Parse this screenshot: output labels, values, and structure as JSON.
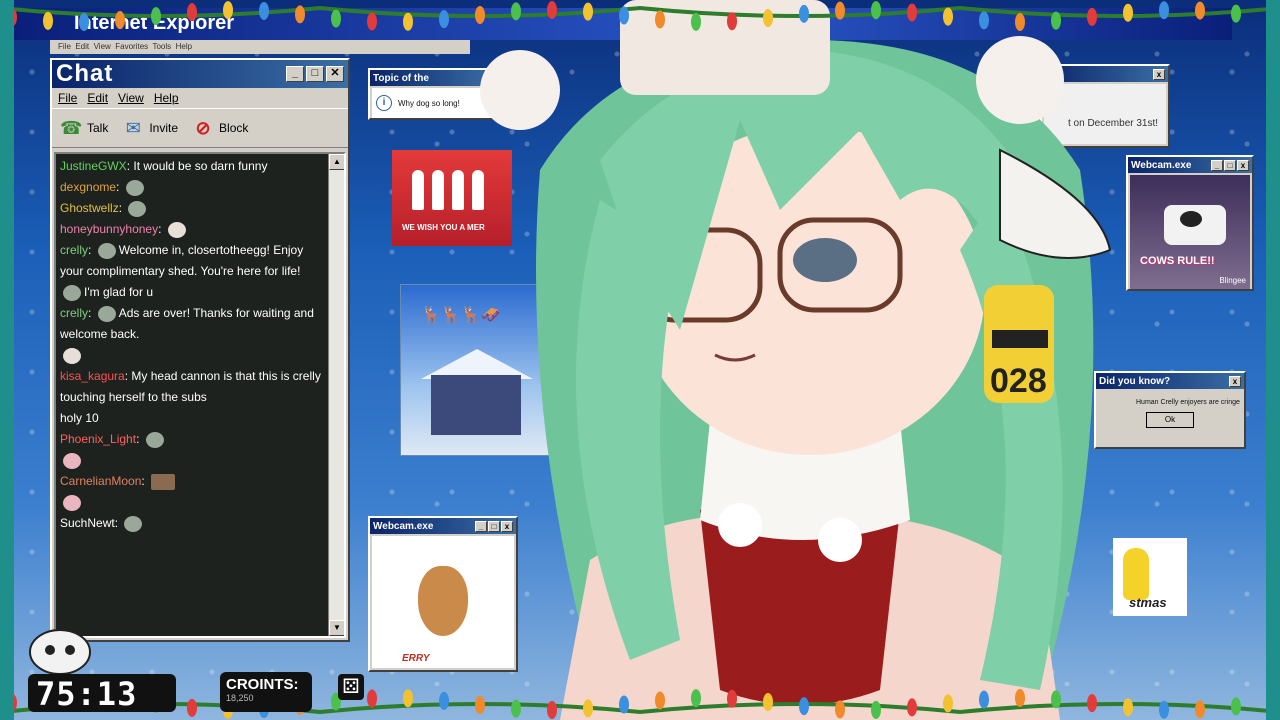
{
  "outer_window": {
    "title": "Internet Explorer",
    "menu": [
      "File",
      "Edit",
      "View",
      "Favorites",
      "Tools",
      "Help"
    ]
  },
  "chat": {
    "title": "Chat",
    "menu": [
      "File",
      "Edit",
      "View",
      "Help"
    ],
    "toolbar": {
      "talk_label": "Talk",
      "invite_label": "Invite",
      "block_label": "Block"
    },
    "messages": [
      {
        "user": "JustineGWX",
        "user_color": "#5fd35f",
        "text": "It would be so darn funny",
        "emote": ""
      },
      {
        "user": "dexgnome",
        "user_color": "#e0a040",
        "text": "",
        "emote": "emote"
      },
      {
        "user": "Ghostwellz",
        "user_color": "#e0c040",
        "text": "",
        "emote": "emote"
      },
      {
        "user": "honeybunnyhoney",
        "user_color": "#f080b0",
        "text": "",
        "emote": "skull"
      },
      {
        "user": "crelly",
        "user_color": "#7fcf7f",
        "text": "Welcome in, closertotheegg! Enjoy your complimentary shed. You're here for life!",
        "emote": "emote"
      },
      {
        "user": "",
        "user_color": "#5060ff",
        "text": "I'm glad for u",
        "emote": "emote"
      },
      {
        "user": "crelly",
        "user_color": "#7fcf7f",
        "text": "Ads are over! Thanks for waiting and welcome back.",
        "emote": "emote"
      },
      {
        "user": "",
        "user_color": "#a050ff",
        "text": "",
        "emote": "skull"
      },
      {
        "user": "kisa_kagura",
        "user_color": "#ff5050",
        "text": "My head cannon is that this is crelly touching herself to the subs",
        "emote": ""
      },
      {
        "user": "",
        "user_color": "#5080ff",
        "text": "holy 10",
        "emote": ""
      },
      {
        "user": "Phoenix_Light",
        "user_color": "#ff6060",
        "text": "",
        "emote": "emote"
      },
      {
        "user": "",
        "user_color": "#8040ff",
        "text": "",
        "emote": "pink"
      },
      {
        "user": "CarnelianMoon",
        "user_color": "#e08060",
        "text": "",
        "emote": "brown"
      },
      {
        "user": "",
        "user_color": "#ff3050",
        "text": "",
        "emote": "pink"
      },
      {
        "user": "SuchNewt",
        "user_color": "#ffffff",
        "text": "",
        "emote": "emote"
      }
    ]
  },
  "topic_window": {
    "title": "Topic of the",
    "text": "Why dog so long!"
  },
  "santa_video": {
    "caption": "WE WISH YOU A MER"
  },
  "webcam_reindeer": {
    "title": "Webcam.exe",
    "caption": "ERRY"
  },
  "right_window": {
    "text": "t on December 31st!"
  },
  "cow_webcam": {
    "title": "Webcam.exe",
    "caption": "COWS RULE!!",
    "sub": "Blingee"
  },
  "dialog": {
    "title": "Did you know?",
    "text": "Human Crelly enjoyers are cringe",
    "ok_label": "Ok"
  },
  "minion": {
    "caption": "stmas"
  },
  "character": {
    "ear_tag": "028"
  },
  "overlay": {
    "timer": "75:13",
    "croints_label": "CROINTS:",
    "croints_value": "18,250"
  },
  "colors": {
    "titlebar": "#0a246a",
    "chat_bg": "#1e221e",
    "hair": "#7fd0a8",
    "teal_border": "#1f8f8c"
  }
}
